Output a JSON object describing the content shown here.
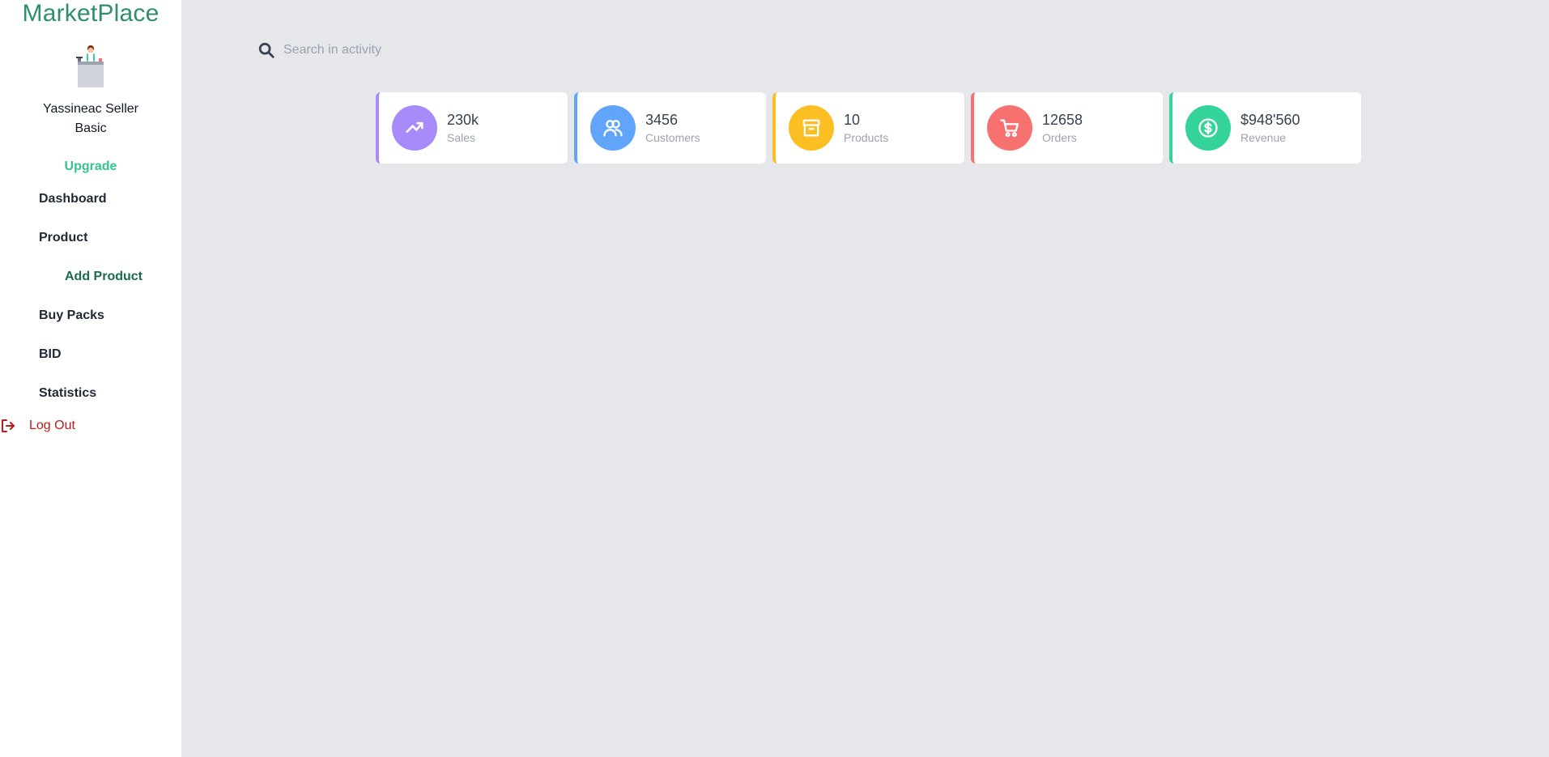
{
  "sidebar": {
    "brand": "MarketPlace",
    "user_name": "Yassineac Seller",
    "user_plan": "Basic",
    "upgrade_label": "Upgrade",
    "nav": {
      "dashboard": "Dashboard",
      "product": "Product",
      "add_product": "Add Product",
      "buy_packs": "Buy Packs",
      "bid": "BID",
      "statistics": "Statistics"
    },
    "logout_label": "Log Out"
  },
  "search": {
    "placeholder": "Search in activity"
  },
  "stats": [
    {
      "value": "230k",
      "label": "Sales",
      "icon": "trending-up-icon",
      "color": "#a78bfa"
    },
    {
      "value": "3456",
      "label": "Customers",
      "icon": "users-icon",
      "color": "#60a5fa"
    },
    {
      "value": "10",
      "label": "Products",
      "icon": "archive-icon",
      "color": "#fbbf24"
    },
    {
      "value": "12658",
      "label": "Orders",
      "icon": "cart-icon",
      "color": "#f87171"
    },
    {
      "value": "$948'560",
      "label": "Revenue",
      "icon": "dollar-icon",
      "color": "#34d399"
    }
  ]
}
